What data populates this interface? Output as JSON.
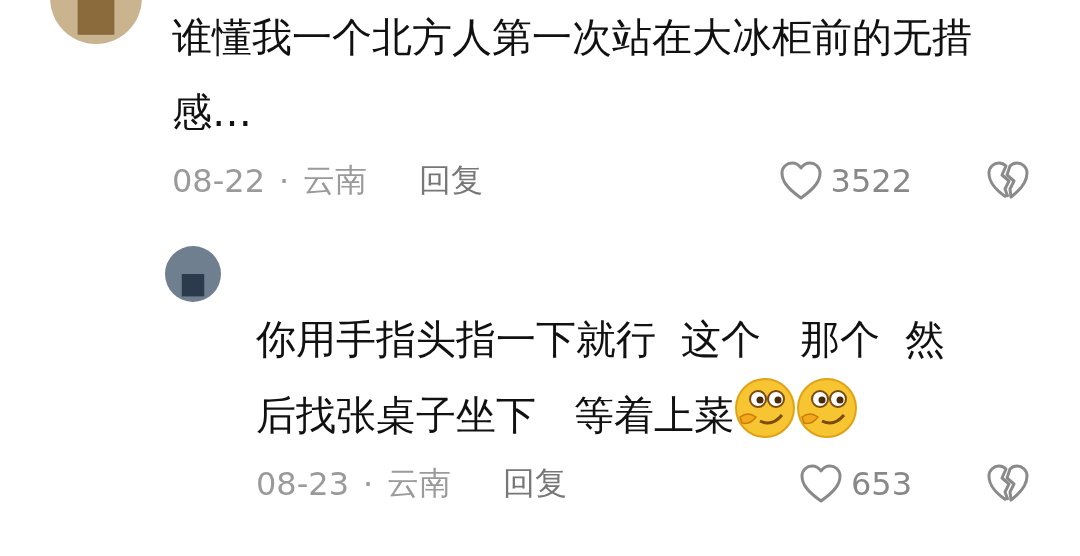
{
  "comments": [
    {
      "text": "谁懂我一个北方人第一次站在大冰柜前的无措感…",
      "date": "08-22",
      "separator": "·",
      "location": "云南",
      "reply_label": "回复",
      "likes": "3522",
      "replies": [
        {
          "text": "你用手指头指一下就行  这个   那个  然后找张桌子坐下   等着上菜",
          "emojis": [
            {
              "kind": "smirk"
            },
            {
              "kind": "smirk"
            }
          ],
          "date": "08-23",
          "separator": "·",
          "location": "云南",
          "reply_label": "回复",
          "likes": "653"
        }
      ]
    }
  ]
}
